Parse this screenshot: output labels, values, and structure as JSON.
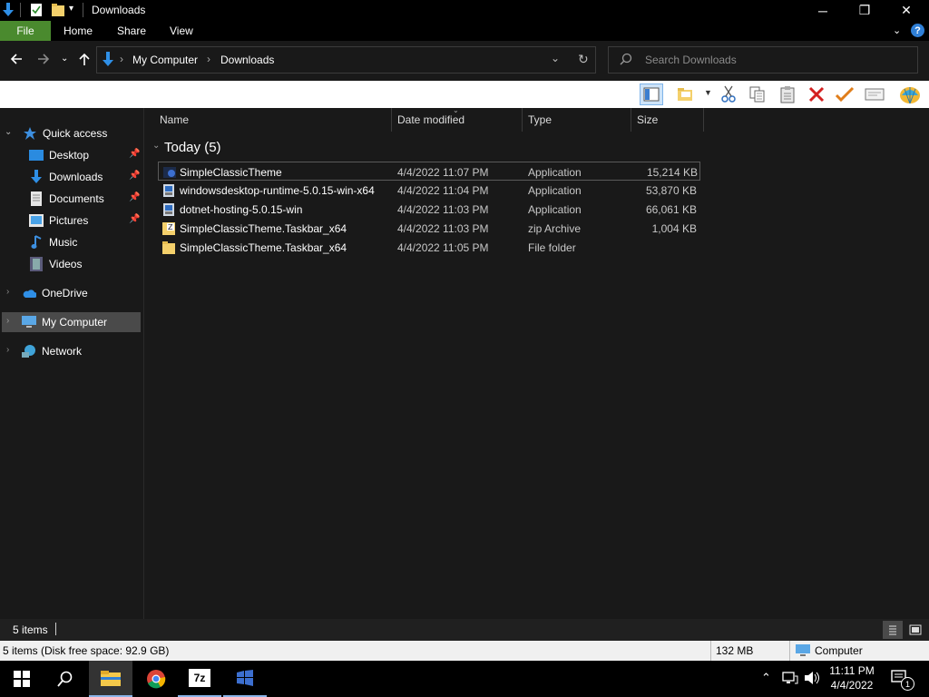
{
  "window": {
    "title": "Downloads",
    "minimize_glyph": "─",
    "maximize_glyph": "❐",
    "close_glyph": "✕"
  },
  "ribbon": {
    "tabs": [
      "File",
      "Home",
      "Share",
      "View"
    ],
    "help_glyph": "?"
  },
  "address": {
    "crumbs": [
      "My Computer",
      "Downloads"
    ],
    "separator": "›",
    "search_placeholder": "Search Downloads"
  },
  "nav": {
    "quick_access": "Quick access",
    "quick_items": [
      "Desktop",
      "Downloads",
      "Documents",
      "Pictures",
      "Music",
      "Videos"
    ],
    "onedrive": "OneDrive",
    "my_computer": "My Computer",
    "network": "Network"
  },
  "columns": {
    "name": "Name",
    "date": "Date modified",
    "type": "Type",
    "size": "Size"
  },
  "group": {
    "label": "Today (5)"
  },
  "files": [
    {
      "name": "SimpleClassicTheme",
      "date": "4/4/2022 11:07 PM",
      "type": "Application",
      "size": "15,214 KB",
      "icon": "app-icon"
    },
    {
      "name": "windowsdesktop-runtime-5.0.15-win-x64",
      "date": "4/4/2022 11:04 PM",
      "type": "Application",
      "size": "53,870 KB",
      "icon": "installer-icon"
    },
    {
      "name": "dotnet-hosting-5.0.15-win",
      "date": "4/4/2022 11:03 PM",
      "type": "Application",
      "size": "66,061 KB",
      "icon": "installer-icon"
    },
    {
      "name": "SimpleClassicTheme.Taskbar_x64",
      "date": "4/4/2022 11:03 PM",
      "type": "zip Archive",
      "size": "1,004 KB",
      "icon": "zip-icon"
    },
    {
      "name": "SimpleClassicTheme.Taskbar_x64",
      "date": "4/4/2022 11:05 PM",
      "type": "File folder",
      "size": "",
      "icon": "folder-icon"
    }
  ],
  "status": {
    "items": "5 items",
    "disk": "5 items (Disk free space: 92.9 GB)",
    "size": "132 MB",
    "location": "Computer"
  },
  "taskbar": {
    "time": "11:11 PM",
    "date": "4/4/2022",
    "notification_count": "1",
    "app_7z_label": "7z"
  },
  "colors": {
    "accent_file_tab": "#4a8a2e",
    "background": "#191919",
    "selected": "#3d3d3d"
  }
}
